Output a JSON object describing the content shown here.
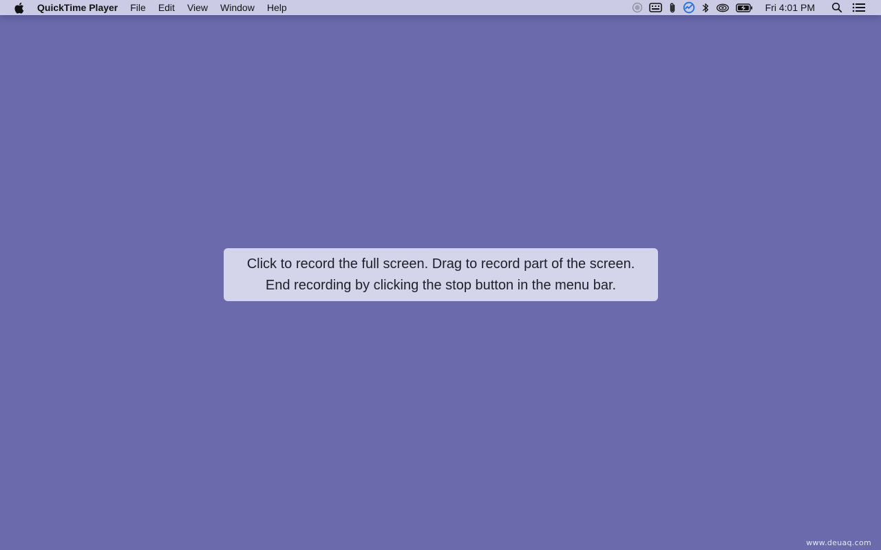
{
  "menubar": {
    "apple_icon": "apple-logo-icon",
    "app_name": "QuickTime Player",
    "menus": [
      "File",
      "Edit",
      "View",
      "Window",
      "Help"
    ],
    "status_icons": [
      "record-stop-icon",
      "keyboard-viewer-icon",
      "paperclip-icon",
      "activity-monitor-icon",
      "bluetooth-icon",
      "wifi-icon",
      "battery-charging-icon"
    ],
    "clock": "Fri 4:01 PM",
    "right_icons": [
      "spotlight-search-icon",
      "notification-center-icon"
    ]
  },
  "recording_hint": {
    "line1": "Click to record the full screen. Drag to record part of the screen.",
    "line2": "End recording by clicking the stop button in the menu bar."
  },
  "watermark": "www.deuaq.com",
  "colors": {
    "desktop": "#6a6aac",
    "menubar": "#cbcbe6",
    "hint_background": "#d4d4ea",
    "activity_accent": "#1f6fe0"
  }
}
